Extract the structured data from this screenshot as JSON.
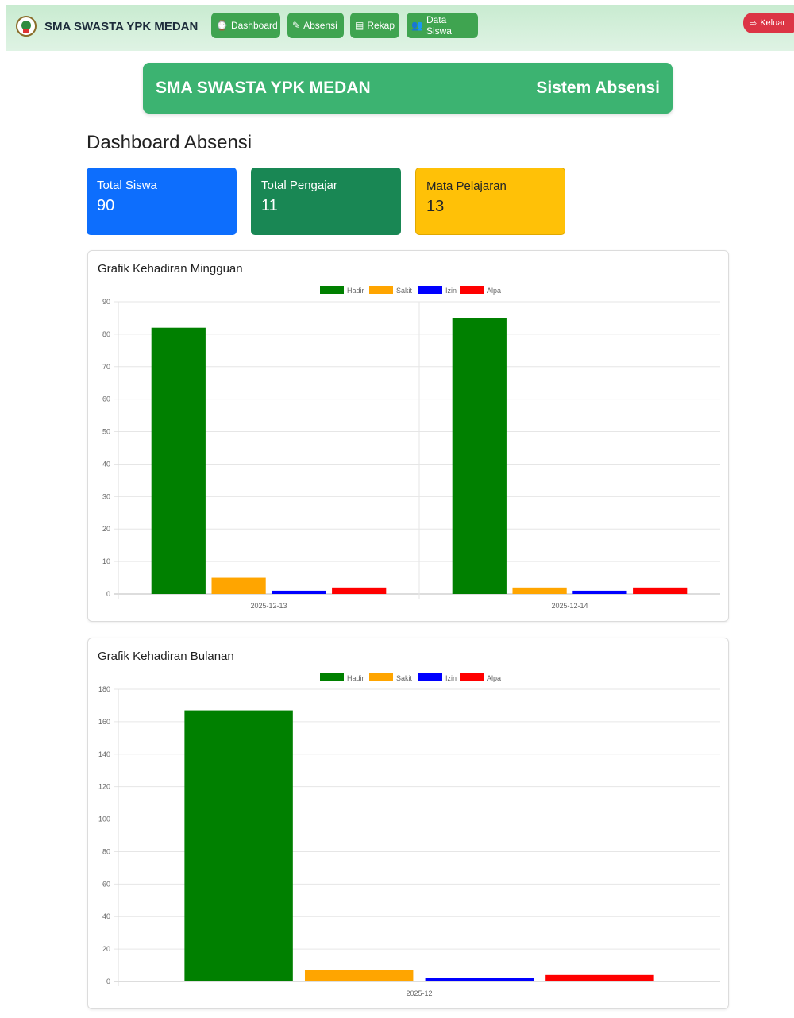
{
  "navbar": {
    "brand": "SMA SWASTA YPK MEDAN",
    "items": [
      {
        "icon": "⌚",
        "label": "Dashboard"
      },
      {
        "icon": "✎",
        "label": "Absensi"
      },
      {
        "icon": "▤",
        "label": "Rekap"
      },
      {
        "icon": "👥",
        "label": "Data Siswa"
      }
    ],
    "logout": "Keluar"
  },
  "banner": {
    "left": "SMA SWASTA YPK MEDAN",
    "right": "Sistem Absensi"
  },
  "page_title": "Dashboard Absensi",
  "stats": [
    {
      "label": "Total Siswa",
      "value": "90",
      "color": "#0d6efd",
      "text_color": "#ffffff"
    },
    {
      "label": "Total Pengajar",
      "value": "11",
      "color": "#198754",
      "text_color": "#ffffff"
    },
    {
      "label": "Mata Pelajaran",
      "value": "13",
      "color": "#ffc107",
      "text_color": "#212529"
    }
  ],
  "colors": {
    "Hadir": "#008000",
    "Sakit": "#ffa500",
    "Izin": "#0000ff",
    "Alpa": "#ff0000"
  },
  "chart_data": [
    {
      "type": "bar",
      "title": "Grafik Kehadiran Mingguan",
      "categories": [
        "2025-12-13",
        "2025-12-14"
      ],
      "series": [
        {
          "name": "Hadir",
          "values": [
            82,
            85
          ]
        },
        {
          "name": "Sakit",
          "values": [
            5,
            2
          ]
        },
        {
          "name": "Izin",
          "values": [
            1,
            1
          ]
        },
        {
          "name": "Alpa",
          "values": [
            2,
            2
          ]
        }
      ],
      "ylim": [
        0,
        90
      ],
      "yticks": [
        0,
        10,
        20,
        30,
        40,
        50,
        60,
        70,
        80,
        90
      ],
      "legend": "top-center",
      "grid": true
    },
    {
      "type": "bar",
      "title": "Grafik Kehadiran Bulanan",
      "categories": [
        "2025-12"
      ],
      "series": [
        {
          "name": "Hadir",
          "values": [
            167
          ]
        },
        {
          "name": "Sakit",
          "values": [
            7
          ]
        },
        {
          "name": "Izin",
          "values": [
            2
          ]
        },
        {
          "name": "Alpa",
          "values": [
            4
          ]
        }
      ],
      "ylim": [
        0,
        180
      ],
      "yticks": [
        0,
        20,
        40,
        60,
        80,
        100,
        120,
        140,
        160,
        180
      ],
      "legend": "top-center",
      "grid": true
    }
  ]
}
